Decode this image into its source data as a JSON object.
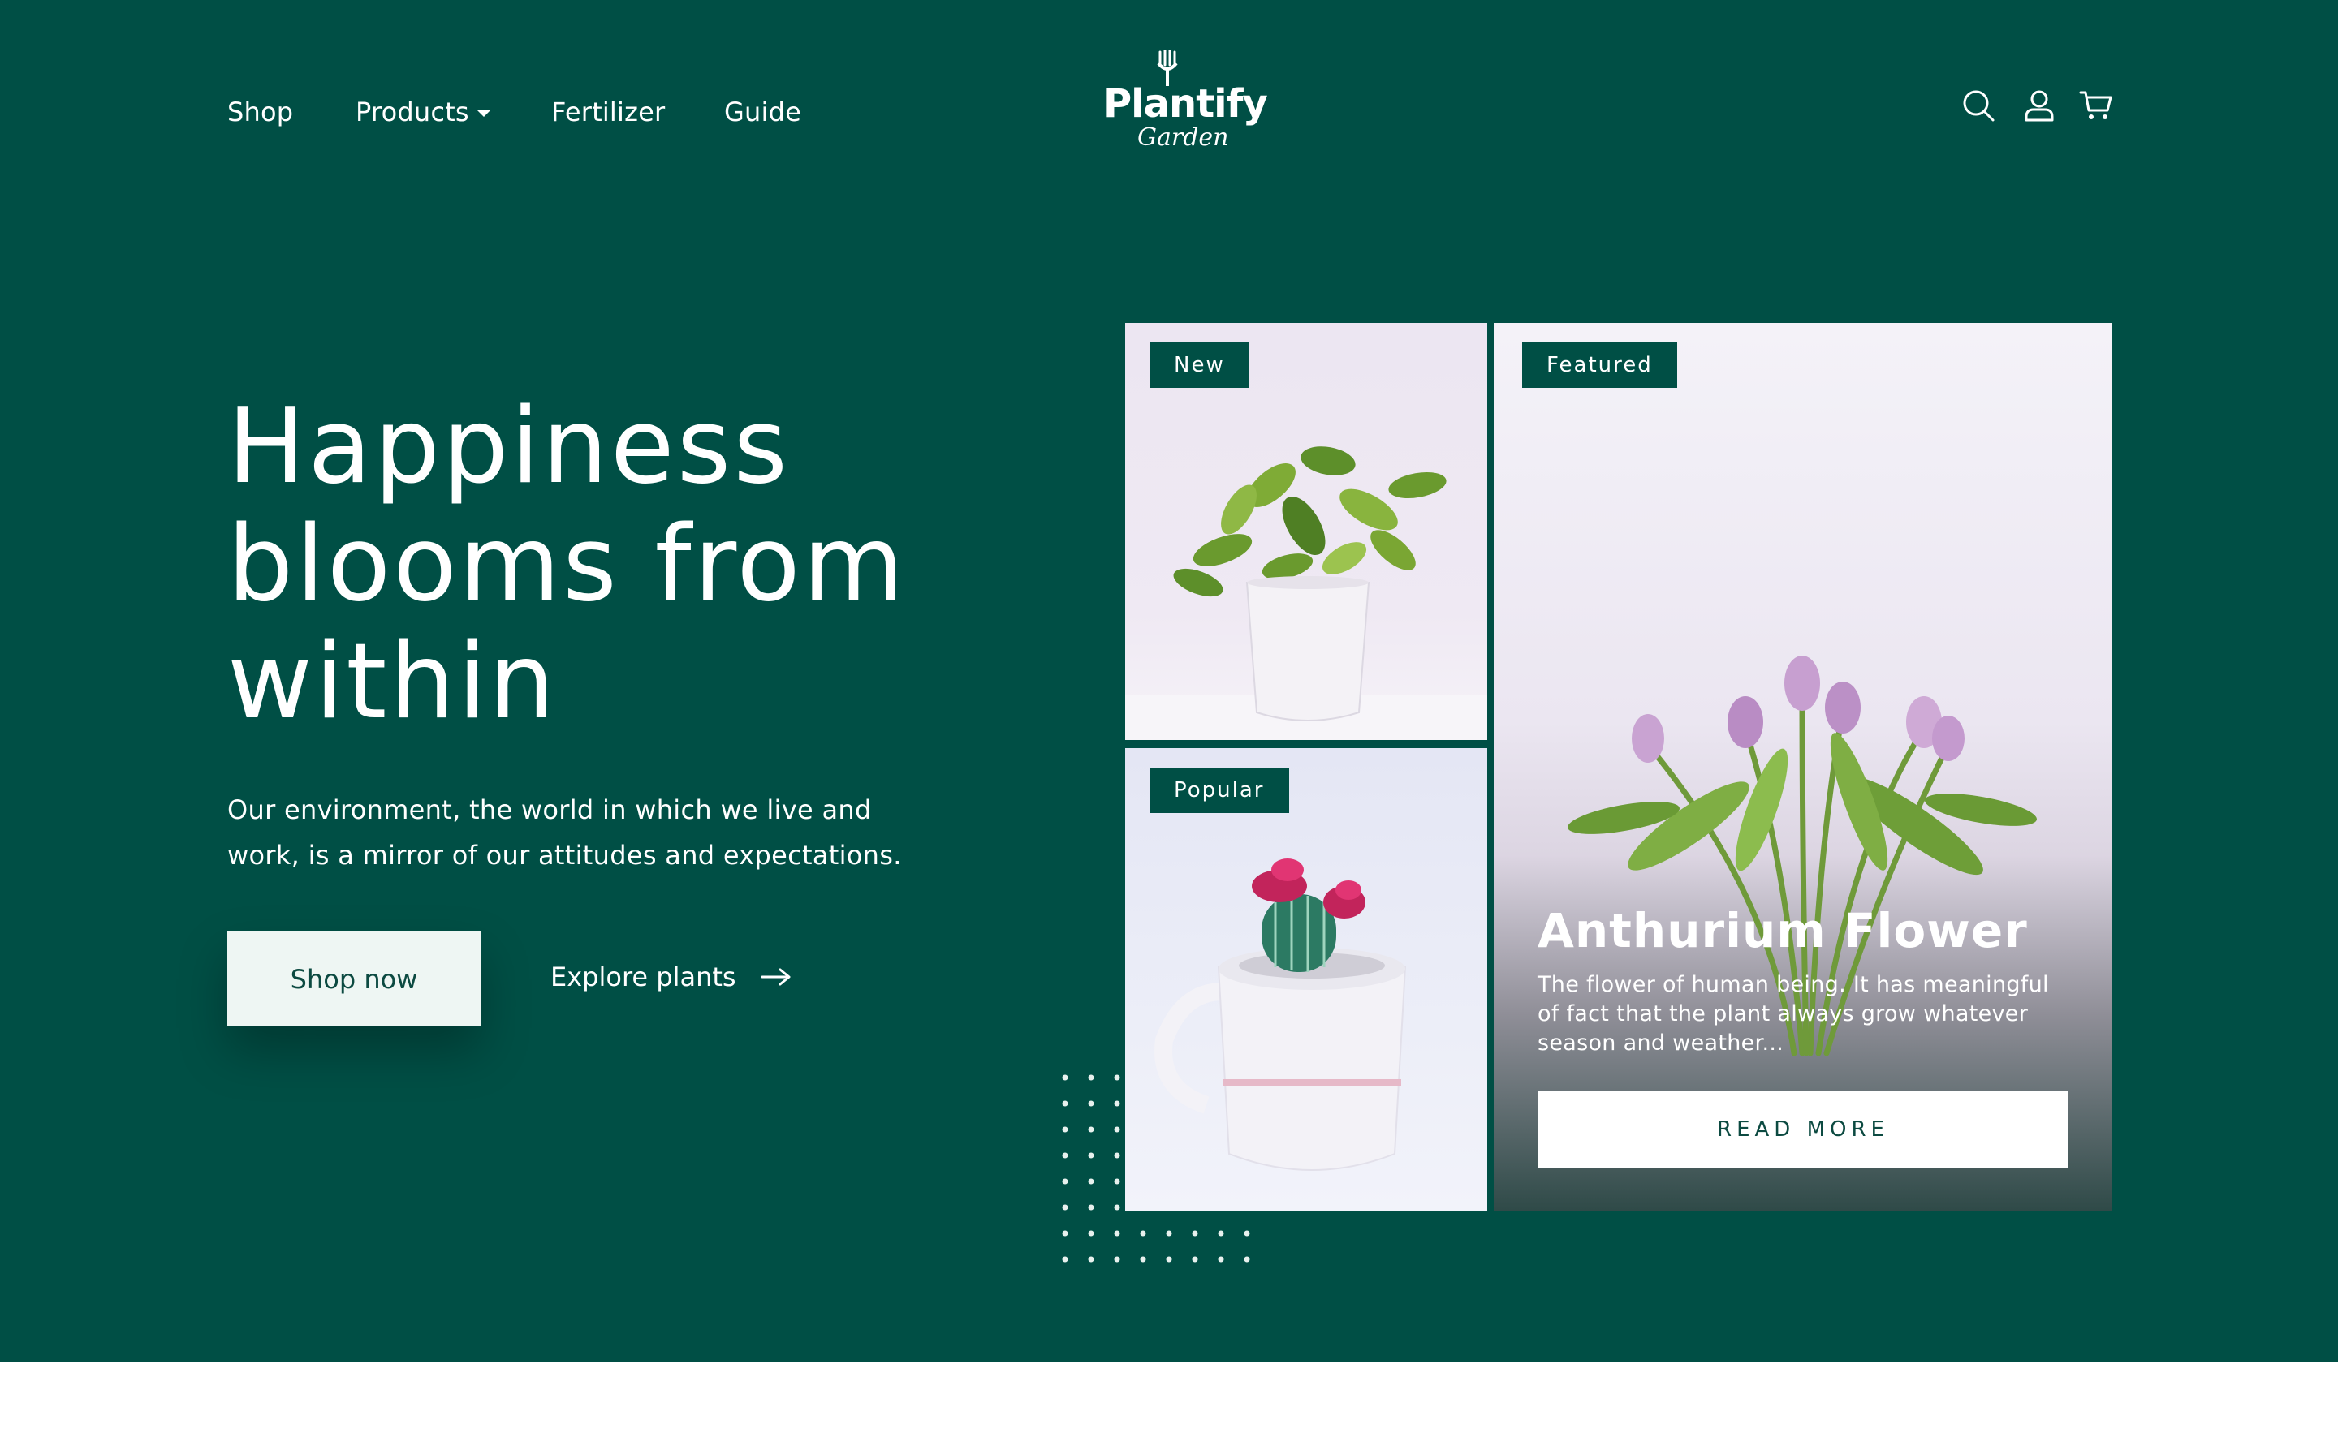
{
  "nav": {
    "links": [
      {
        "label": "Shop"
      },
      {
        "label": "Products"
      },
      {
        "label": "Fertilizer"
      },
      {
        "label": "Guide"
      }
    ]
  },
  "logo": {
    "word": "Plantify",
    "script": "Garden"
  },
  "header_icons": [
    "search-icon",
    "user-icon",
    "cart-icon"
  ],
  "hero": {
    "headline": [
      "Happiness",
      "blooms from",
      "within"
    ],
    "subtext": "Our environment, the world in which we live and work, is a mirror of our attitudes and expectations.",
    "primary_button": "Shop now",
    "secondary_button": "Explore plants"
  },
  "cards": {
    "new": {
      "badge": "New"
    },
    "popular": {
      "badge": "Popular"
    },
    "featured": {
      "badge": "Featured",
      "title": "Anthurium Flower",
      "description": "The flower of human being. It has meaningful of fact that the plant always grow whatever season and weather...",
      "button": "READ MORE"
    }
  },
  "colors": {
    "hero_bg": "#004f45",
    "button_light": "#eef6f3",
    "text_dark_green": "#0c4a41",
    "page_bg": "#ffffff"
  }
}
